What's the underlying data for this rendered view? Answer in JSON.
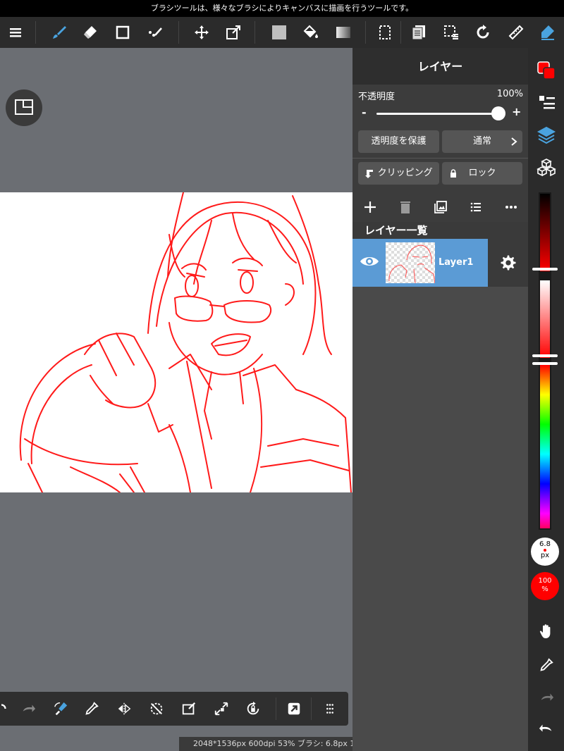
{
  "hint": "ブラシツールは、様々なブラシによりキャンバスに描画を行うツールです。",
  "toolbar": {
    "icons": [
      "menu-icon",
      "brush-icon",
      "eraser-icon",
      "rectangle-icon",
      "dot-icon",
      "move-icon",
      "transform-icon",
      "fill-icon",
      "bucket-icon",
      "gradation-icon",
      "select-icon",
      "layer-copy-icon",
      "select-layer-icon",
      "rotate-icon",
      "ruler-icon",
      "pen-icon"
    ]
  },
  "panel": {
    "title": "レイヤー",
    "opacity_label": "不透明度",
    "opacity_value": "100%",
    "opacity": 1.0,
    "minus": "-",
    "plus": "+",
    "protect_alpha": "透明度を保護",
    "blend_mode": "通常",
    "clipping": "クリッピング",
    "lock": "ロック",
    "list_header": "レイヤー一覧",
    "layers": [
      {
        "name": "Layer1",
        "visible": true
      }
    ]
  },
  "sidebar": {
    "brush_size": "6.8",
    "brush_size_unit": "px",
    "brush_alpha": "100",
    "brush_alpha_unit": "%",
    "color": "#ff0000"
  },
  "status": "2048*1536px 600dpi 53% ブラシ: 6.8px 1",
  "colors": {
    "accent": "#5b9bd5",
    "brush": "#ff0000",
    "icon_blue": "#4aa3df"
  }
}
